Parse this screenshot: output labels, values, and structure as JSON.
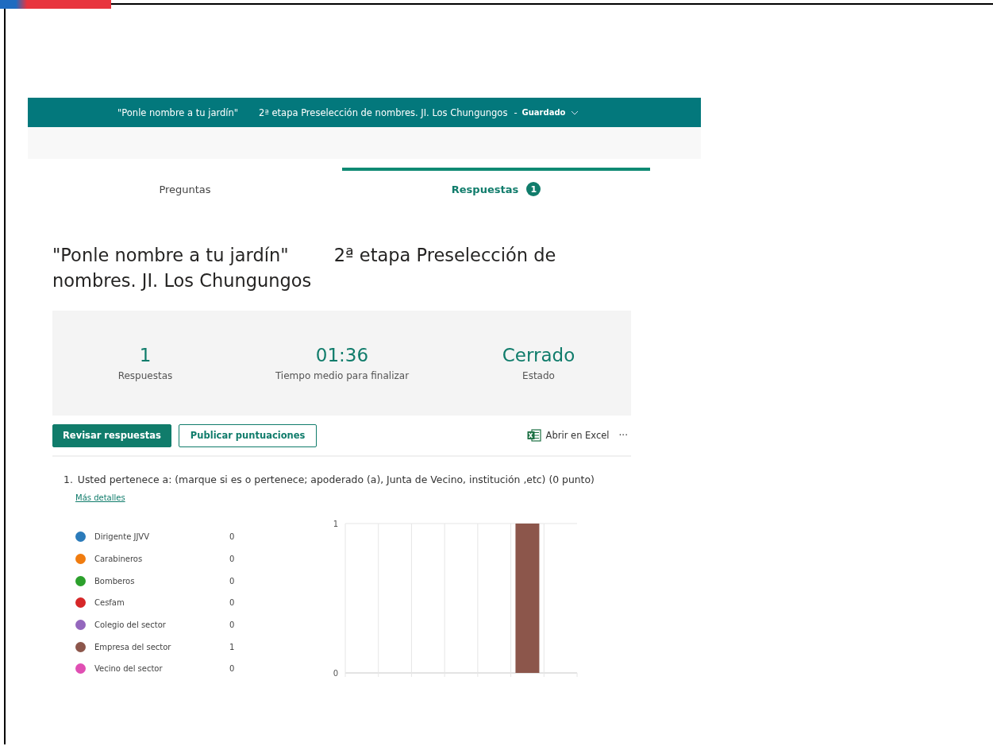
{
  "header": {
    "form_name": "\"Ponle nombre a tu jardín\"",
    "form_subtitle": "2ª etapa Preselección de nombres. JI. Los Chungungos",
    "separator": "-",
    "save_status": "Guardado"
  },
  "tabs": [
    {
      "label": "Preguntas",
      "selected": false
    },
    {
      "label": "Respuestas",
      "selected": true,
      "badge": "1"
    }
  ],
  "form_title": "\"Ponle nombre a tu jardín\"        2ª etapa Preselección de nombres. JI. Los Chungungos",
  "stats": [
    {
      "value": "1",
      "label": "Respuestas"
    },
    {
      "value": "01:36",
      "label": "Tiempo medio para finalizar"
    },
    {
      "value": "Cerrado",
      "label": "Estado"
    }
  ],
  "actions": {
    "review_button": "Revisar respuestas",
    "publish_button": "Publicar puntuaciones",
    "excel_link": "Abrir en Excel",
    "more": "···"
  },
  "question": {
    "number": "1.",
    "text": "Usted pertenece a:  (marque si es o pertenece; apoderado (a), Junta de Vecino, institución ,etc) (0 punto)",
    "details_link": "Más detalles",
    "options": [
      {
        "label": "Dirigente JJVV",
        "count": "0",
        "color": "#2b7bba"
      },
      {
        "label": "Carabineros",
        "count": "0",
        "color": "#f07c0f"
      },
      {
        "label": "Bomberos",
        "count": "0",
        "color": "#2ca02c"
      },
      {
        "label": "Cesfam",
        "count": "0",
        "color": "#d62728"
      },
      {
        "label": "Colegio del sector",
        "count": "0",
        "color": "#9467bd"
      },
      {
        "label": "Empresa del sector",
        "count": "1",
        "color": "#8c564b"
      },
      {
        "label": "Vecino del sector",
        "count": "0",
        "color": "#e04fb3"
      }
    ],
    "chart_data": {
      "type": "bar",
      "values": [
        0,
        0,
        0,
        0,
        0,
        1,
        0
      ],
      "ylim": [
        0,
        1
      ],
      "yticks": [
        0,
        1
      ]
    }
  }
}
